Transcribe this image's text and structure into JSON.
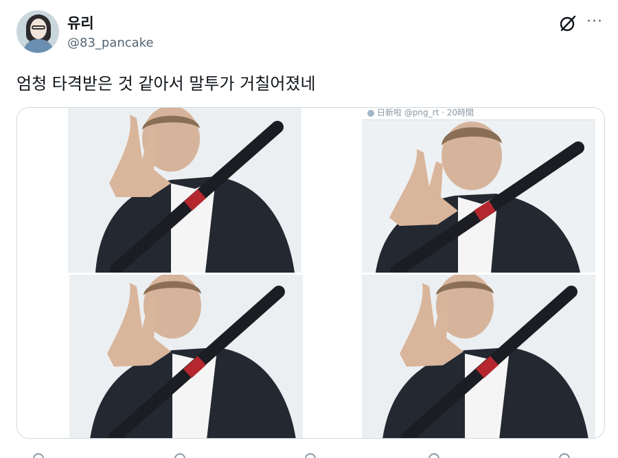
{
  "user": {
    "display_name": "유리",
    "handle": "@83_pancake"
  },
  "post": {
    "text": "엄청 타격받은 것 같아서 말투가 거칠어졌네"
  },
  "icons": {
    "grok": "grok-icon",
    "more": "more-icon"
  },
  "media": {
    "photo_count": 4,
    "quote_text": "日新啦 @png_rt · 20時間"
  }
}
